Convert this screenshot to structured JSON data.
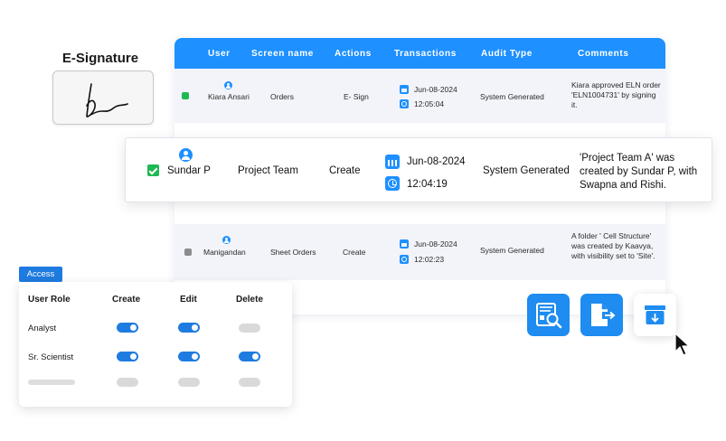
{
  "esignature": {
    "title": "E-Signature"
  },
  "table": {
    "headers": [
      "User",
      "Screen name",
      "Actions",
      "Transactions",
      "Audit Type",
      "Comments"
    ],
    "rows": [
      {
        "user": "Kiara Ansari",
        "screen": "Orders",
        "action": "E- Sign",
        "date": "Jun-08-2024",
        "time": "12:05:04",
        "audit": "System Generated",
        "comment": "Kiara approved ELN order 'ELN1004731' by signing it.",
        "status": "checked"
      },
      {
        "user": "Manigandan",
        "screen": "Sheet Orders",
        "action": "Create",
        "date": "Jun-08-2024",
        "time": "12:02:23",
        "audit": "System Generated",
        "comment": "A folder ' Cell Structure' was created by Kaavya, with visibility set to 'Site'.",
        "status": "unchecked"
      }
    ]
  },
  "highlight": {
    "user": "Sundar P",
    "screen": "Project Team",
    "action": "Create",
    "date": "Jun-08-2024",
    "time": "12:04:19",
    "audit": "System Generated",
    "comment": "'Project Team A' was created by Sundar P, with Swapna and Rishi.",
    "status": "checked"
  },
  "access": {
    "tab_label": "Access",
    "headers": [
      "User Role",
      "Create",
      "Edit",
      "Delete"
    ],
    "roles": [
      {
        "name": "Analyst",
        "create": true,
        "edit": true,
        "delete": false
      },
      {
        "name": "Sr. Scientist",
        "create": true,
        "edit": true,
        "delete": true
      },
      {
        "name": "",
        "create": false,
        "edit": false,
        "delete": false
      }
    ]
  },
  "actions": [
    {
      "name": "audit-report-search",
      "icon": "report-search-icon"
    },
    {
      "name": "export",
      "icon": "export-file-icon"
    },
    {
      "name": "archive-download",
      "icon": "archive-download-icon"
    }
  ],
  "colors": {
    "accent": "#1e90ff",
    "success": "#1fb954",
    "toggle_off": "#d9d9d9"
  }
}
